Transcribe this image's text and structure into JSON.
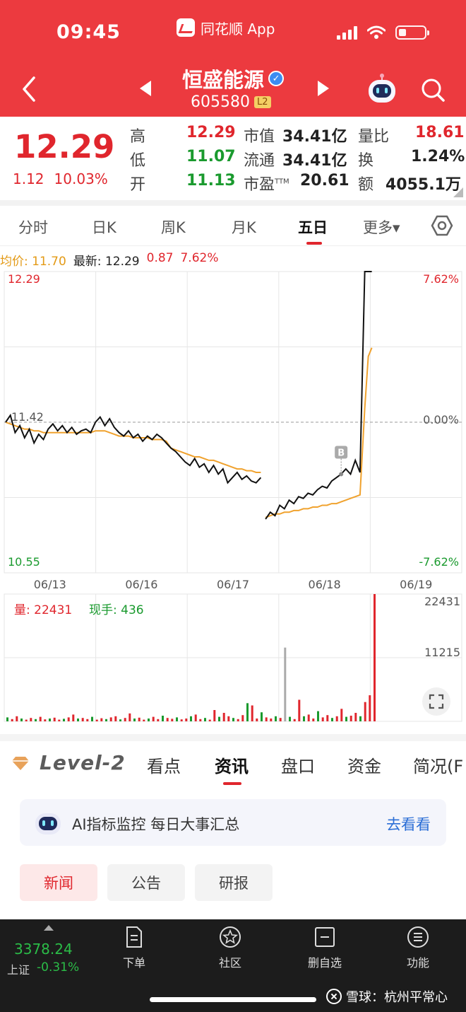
{
  "status_bar": {
    "time": "09:45",
    "app_name": "同花顺 App"
  },
  "header": {
    "stock_name": "恒盛能源",
    "stock_code": "605580",
    "level_badge": "L2"
  },
  "quote": {
    "price": "12.29",
    "change": "1.12",
    "change_pct": "10.03%",
    "rows": [
      {
        "label": "高",
        "value": "12.29"
      },
      {
        "label": "低",
        "value": "11.07"
      },
      {
        "label": "开",
        "value": "11.13"
      }
    ],
    "metrics": [
      {
        "label": "市值",
        "value": "34.41亿"
      },
      {
        "label": "流通",
        "value": "34.41亿"
      },
      {
        "label": "市盈",
        "sup": "TTM",
        "value": "20.61"
      }
    ],
    "metrics2": [
      {
        "label": "量比",
        "value": "18.61"
      },
      {
        "label": "换",
        "value": "1.24%"
      },
      {
        "label": "额",
        "value": "4055.1万"
      }
    ]
  },
  "chart_tabs": [
    "分时",
    "日K",
    "周K",
    "月K",
    "五日",
    "更多▾"
  ],
  "chart_info": {
    "avg_label": "均价: 11.70",
    "latest_label": "最新: 12.29",
    "delta": "0.87",
    "delta_pct": "7.62%"
  },
  "chart_data": [
    {
      "type": "line",
      "x": [
        "06/13",
        "06/16",
        "06/17",
        "06/18",
        "06/19"
      ],
      "ylim": [
        10.55,
        12.29
      ],
      "y_tick_labels": [
        "12.29",
        "11.42",
        "10.55"
      ],
      "right_tick_labels": [
        "7.62%",
        "0.00%",
        "-7.62%"
      ],
      "reference_line": 11.42,
      "marker": "B",
      "series": [
        {
          "values": [
            11.42,
            11.46,
            11.36,
            11.4,
            11.33,
            11.38,
            11.3,
            11.35,
            11.32,
            11.38,
            11.41,
            11.37,
            11.4,
            11.36,
            11.39,
            11.35,
            11.37,
            11.38,
            11.36,
            11.42,
            11.45,
            11.4,
            11.44,
            11.39,
            11.36,
            11.34,
            11.37,
            11.33,
            11.35,
            11.31,
            11.34,
            11.32,
            11.35,
            11.33,
            11.3,
            11.27,
            11.25,
            11.22,
            11.19,
            11.17,
            11.21,
            11.16,
            11.18,
            11.13,
            11.17,
            11.12,
            11.15,
            11.07,
            11.1,
            11.13,
            11.09,
            11.11,
            11.08,
            11.07,
            11.1,
            10.86,
            10.9,
            10.88,
            10.94,
            10.92,
            10.97,
            10.95,
            10.99,
            10.98,
            11.01,
            11.0,
            11.03,
            11.05,
            11.04,
            11.08,
            11.1,
            11.12,
            11.15,
            11.12,
            11.2,
            11.13,
            12.29,
            12.29,
            12.29
          ]
        },
        {
          "values": [
            11.42,
            11.41,
            11.4,
            11.39,
            11.38,
            11.38,
            11.37,
            11.37,
            11.36,
            11.36,
            11.36,
            11.36,
            11.36,
            11.36,
            11.36,
            11.36,
            11.36,
            11.36,
            11.36,
            11.37,
            11.37,
            11.37,
            11.36,
            11.35,
            11.34,
            11.34,
            11.34,
            11.33,
            11.33,
            11.33,
            11.33,
            11.32,
            11.32,
            11.32,
            11.31,
            11.27,
            11.26,
            11.25,
            11.24,
            11.23,
            11.22,
            11.22,
            11.21,
            11.2,
            11.2,
            11.19,
            11.18,
            11.17,
            11.16,
            11.15,
            11.15,
            11.14,
            11.14,
            11.13,
            11.13,
            10.87,
            10.88,
            10.89,
            10.89,
            10.9,
            10.9,
            10.91,
            10.91,
            10.92,
            10.92,
            10.93,
            10.93,
            10.94,
            10.94,
            10.95,
            10.95,
            10.96,
            10.97,
            10.98,
            10.99,
            11.0,
            11.5,
            11.8,
            11.85
          ]
        }
      ]
    },
    {
      "type": "bar",
      "ylim": [
        0,
        22431
      ],
      "y_tick_labels": [
        "22431",
        "11215"
      ],
      "volume_label": "量: 22431",
      "current_hand_label": "现手: 436",
      "values": [
        700,
        400,
        900,
        500,
        300,
        600,
        400,
        800,
        350,
        500,
        650,
        300,
        450,
        700,
        1200,
        500,
        600,
        400,
        800,
        300,
        550,
        400,
        700,
        900,
        350,
        600,
        1400,
        500,
        650,
        300,
        500,
        800,
        400,
        1000,
        600,
        450,
        700,
        350,
        500,
        900,
        1200,
        400,
        600,
        300,
        2000,
        800,
        1500,
        900,
        600,
        400,
        1100,
        3200,
        2800,
        500,
        1600,
        700,
        500,
        900,
        600,
        13000,
        800,
        400,
        3800,
        900,
        1200,
        500,
        1800,
        700,
        1100,
        600,
        900,
        2200,
        800,
        1000,
        1500,
        900,
        3400,
        4600,
        22431
      ]
    }
  ],
  "info_tabs": {
    "level2_label": "Level-2",
    "tabs": [
      "看点",
      "资讯",
      "盘口",
      "资金",
      "简况(F"
    ]
  },
  "ai_banner": {
    "text": "AI指标监控 每日大事汇总",
    "link": "去看看"
  },
  "sub_tabs": [
    "新闻",
    "公告",
    "研报"
  ],
  "bottom_bar": {
    "index_value": "3378.24",
    "index_name": "上证",
    "index_change": "-0.31%",
    "nav": [
      "下单",
      "社区",
      "删自选",
      "功能"
    ]
  },
  "watermark": "雪球：杭州平常心",
  "colors": {
    "brand_red": "#ec3a3f",
    "up": "#e0262d",
    "down": "#1a9a2e",
    "avg_line": "#f0a22e"
  }
}
